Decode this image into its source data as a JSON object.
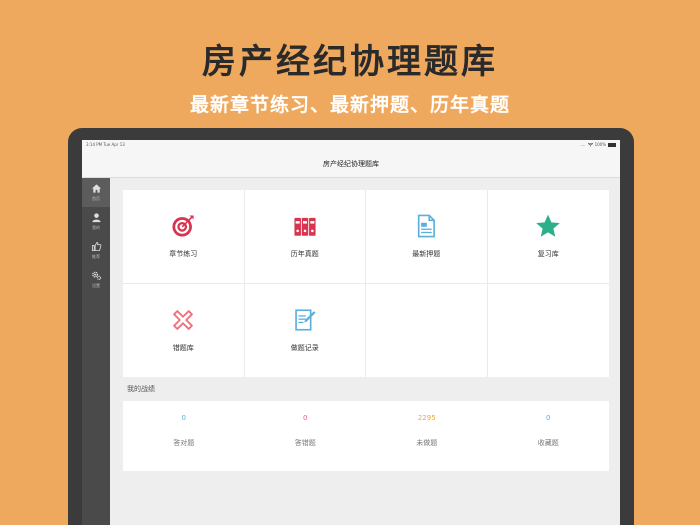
{
  "promo": {
    "title": "房产经纪协理题库",
    "subtitle": "最新章节练习、最新押题、历年真题"
  },
  "statusbar": {
    "time": "3:14 PM",
    "date": "Tue Apr 13",
    "signal": "....",
    "battery": "100%"
  },
  "navbar": {
    "title": "房产经纪协理题库"
  },
  "sidebar": {
    "items": [
      {
        "label": "首页",
        "icon": "home-icon",
        "active": true
      },
      {
        "label": "我的",
        "icon": "user-icon",
        "active": false
      },
      {
        "label": "推荐",
        "icon": "thumbs-up-icon",
        "active": false
      },
      {
        "label": "设置",
        "icon": "gear-icon",
        "active": false
      }
    ]
  },
  "modules": [
    {
      "label": "章节练习",
      "icon": "target-icon",
      "color": "#D9334F"
    },
    {
      "label": "历年真题",
      "icon": "binders-icon",
      "color": "#D9334F"
    },
    {
      "label": "最新押题",
      "icon": "document-icon",
      "color": "#5BAFDF"
    },
    {
      "label": "复习库",
      "icon": "star-icon",
      "color": "#2BB08B"
    },
    {
      "label": "错题库",
      "icon": "cross-icon",
      "color": "#EF6F7A"
    },
    {
      "label": "做题记录",
      "icon": "edit-record-icon",
      "color": "#5BAFDF"
    }
  ],
  "stats": {
    "title": "我的战绩",
    "items": [
      {
        "value": "0",
        "label": "答对题",
        "color": "#5BAFDF"
      },
      {
        "value": "0",
        "label": "答错题",
        "color": "#EF5A78"
      },
      {
        "value": "2295",
        "label": "未做题",
        "color": "#F5A623"
      },
      {
        "value": "0",
        "label": "收藏题",
        "color": "#5BAFDF"
      }
    ]
  }
}
